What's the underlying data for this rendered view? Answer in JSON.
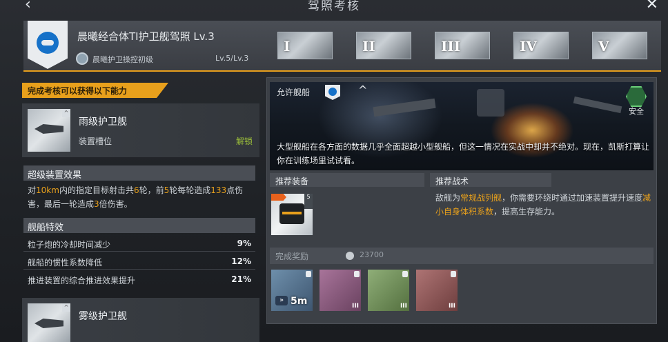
{
  "topbar": {
    "title": "驾照考核",
    "back_icon": "chevron-left-icon",
    "close_icon": "close-icon"
  },
  "header": {
    "license_title": "晨曦经合体TI护卫舰驾照 Lv.3",
    "skill_name": "晨曦护卫操控初级",
    "skill_level": "Lv.5/Lv.3",
    "stages": [
      "I",
      "II",
      "III",
      "IV",
      "V"
    ],
    "accent": "#e8a01c"
  },
  "left": {
    "banner": "完成考核可以获得以下能力",
    "ship_card": {
      "name": "雨级护卫舰",
      "slot": "装置槽位",
      "unlock": "解锁"
    },
    "super_effect": {
      "heading": "超级装置效果",
      "desc_parts": [
        "对",
        "10km",
        "内的指定目标射击共",
        "6",
        "轮，前",
        "5",
        "轮每轮造成",
        "133",
        "点伤害，最后一轮造成",
        "3",
        "倍伤害。"
      ]
    },
    "traits": {
      "heading": "舰船特效",
      "rows": [
        {
          "label": "粒子炮的冷却时间减少",
          "value": "9%"
        },
        {
          "label": "舰船的惯性系数降低",
          "value": "12%"
        },
        {
          "label": "推进装置的综合推进效果提升",
          "value": "21%"
        }
      ]
    },
    "next_ship": {
      "name": "雾级护卫舰"
    }
  },
  "right": {
    "allowed_label": "允许舰船",
    "safe_label": "安全",
    "scene_desc": "大型舰船在各方面的数据几乎全面超越小型舰船，但这一情况在实战中却并不绝对。现在，凯斯打算让你在训练场里试试看。",
    "recommended_equip_label": "推荐装备",
    "equip_level": "5",
    "recommended_tactic_label": "推荐战术",
    "tactic_parts": [
      "敌舰为",
      "常规战列舰",
      "，你需要环绕时通过加速装置提升速度",
      "减小自身体积系数",
      "，提高生存能力。"
    ],
    "reward_label": "完成奖励",
    "reward_amount": "23700",
    "rewards": [
      {
        "name": "boost-module",
        "amount": "5m",
        "tier": "",
        "color": "#4a6a86"
      },
      {
        "name": "pink-parts",
        "amount": "",
        "tier": "III",
        "color": "#8a5a7a"
      },
      {
        "name": "green-parts",
        "amount": "",
        "tier": "III",
        "color": "#6e8a5a"
      },
      {
        "name": "red-parts",
        "amount": "",
        "tier": "III",
        "color": "#8a5454"
      }
    ]
  }
}
